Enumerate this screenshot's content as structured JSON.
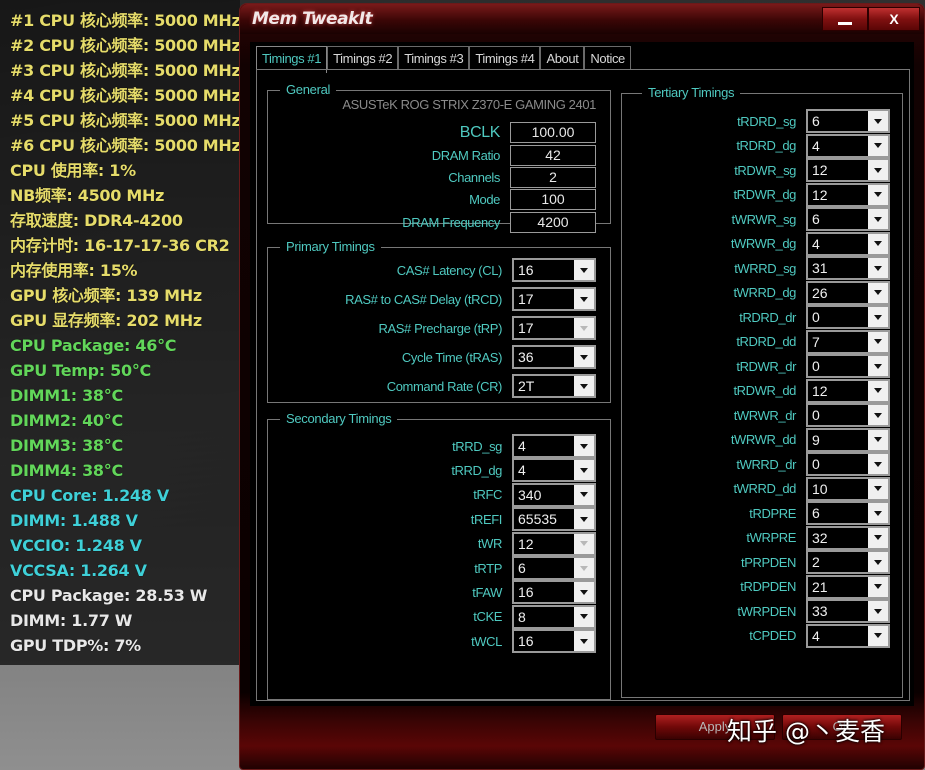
{
  "osd": {
    "lines": [
      {
        "text": "#1 CPU 核心频率: 5000 MHz",
        "color": "yellow"
      },
      {
        "text": "#2 CPU 核心频率: 5000 MHz",
        "color": "yellow"
      },
      {
        "text": "#3 CPU 核心频率: 5000 MHz",
        "color": "yellow"
      },
      {
        "text": "#4 CPU 核心频率: 5000 MHz",
        "color": "yellow"
      },
      {
        "text": "#5 CPU 核心频率: 5000 MHz",
        "color": "yellow"
      },
      {
        "text": "#6 CPU 核心频率: 5000 MHz",
        "color": "yellow"
      },
      {
        "text": "CPU 使用率: 1%",
        "color": "yellow"
      },
      {
        "text": "NB频率: 4500 MHz",
        "color": "yellow"
      },
      {
        "text": "存取速度: DDR4-4200",
        "color": "yellow"
      },
      {
        "text": "内存计时: 16-17-17-36 CR2",
        "color": "yellow"
      },
      {
        "text": "内存使用率: 15%",
        "color": "yellow"
      },
      {
        "text": "GPU 核心频率: 139 MHz",
        "color": "yellow"
      },
      {
        "text": "GPU 显存频率: 202 MHz",
        "color": "yellow"
      },
      {
        "text": "CPU Package: 46°C",
        "color": "green"
      },
      {
        "text": "GPU Temp: 50°C",
        "color": "green"
      },
      {
        "text": "DIMM1: 38°C",
        "color": "green"
      },
      {
        "text": "DIMM2: 40°C",
        "color": "green"
      },
      {
        "text": "DIMM3: 38°C",
        "color": "green"
      },
      {
        "text": "DIMM4: 38°C",
        "color": "green"
      },
      {
        "text": "CPU Core: 1.248 V",
        "color": "cyan"
      },
      {
        "text": "DIMM: 1.488 V",
        "color": "cyan"
      },
      {
        "text": "VCCIO: 1.248 V",
        "color": "cyan"
      },
      {
        "text": "VCCSA: 1.264 V",
        "color": "cyan"
      },
      {
        "text": "CPU Package: 28.53 W",
        "color": "white"
      },
      {
        "text": "DIMM: 1.77 W",
        "color": "white"
      },
      {
        "text": "GPU TDP%: 7%",
        "color": "white"
      }
    ]
  },
  "window": {
    "title": "Mem TweakIt",
    "minimize_icon": "minimize-icon",
    "close_label": "X",
    "tabs": [
      {
        "label": "Timings #1",
        "active": true
      },
      {
        "label": "Timings #2",
        "active": false
      },
      {
        "label": "Timings #3",
        "active": false
      },
      {
        "label": "Timings #4",
        "active": false
      },
      {
        "label": "About",
        "active": false
      },
      {
        "label": "Notice",
        "active": false
      }
    ],
    "general": {
      "title": "General",
      "board": "ASUSTeK ROG STRIX Z370-E GAMING 2401",
      "fields": [
        {
          "label": "BCLK",
          "value": "100.00"
        },
        {
          "label": "DRAM Ratio",
          "value": "42"
        },
        {
          "label": "Channels",
          "value": "2"
        },
        {
          "label": "Mode",
          "value": "100"
        },
        {
          "label": "DRAM Frequency",
          "value": "4200"
        }
      ]
    },
    "primary": {
      "title": "Primary Timings",
      "fields": [
        {
          "label": "CAS# Latency (CL)",
          "value": "16",
          "disabled": false
        },
        {
          "label": "RAS# to CAS# Delay (tRCD)",
          "value": "17",
          "disabled": false
        },
        {
          "label": "RAS# Precharge (tRP)",
          "value": "17",
          "disabled": true
        },
        {
          "label": "Cycle Time (tRAS)",
          "value": "36",
          "disabled": false
        },
        {
          "label": "Command Rate (CR)",
          "value": "2T",
          "disabled": false
        }
      ]
    },
    "secondary": {
      "title": "Secondary Timings",
      "fields": [
        {
          "label": "tRRD_sg",
          "value": "4",
          "disabled": false
        },
        {
          "label": "tRRD_dg",
          "value": "4",
          "disabled": false
        },
        {
          "label": "tRFC",
          "value": "340",
          "disabled": false
        },
        {
          "label": "tREFI",
          "value": "65535",
          "disabled": false
        },
        {
          "label": "tWR",
          "value": "12",
          "disabled": true
        },
        {
          "label": "tRTP",
          "value": "6",
          "disabled": true
        },
        {
          "label": "tFAW",
          "value": "16",
          "disabled": false
        },
        {
          "label": "tCKE",
          "value": "8",
          "disabled": false
        },
        {
          "label": "tWCL",
          "value": "16",
          "disabled": false
        }
      ]
    },
    "tertiary": {
      "title": "Tertiary Timings",
      "fields": [
        {
          "label": "tRDRD_sg",
          "value": "6"
        },
        {
          "label": "tRDRD_dg",
          "value": "4"
        },
        {
          "label": "tRDWR_sg",
          "value": "12"
        },
        {
          "label": "tRDWR_dg",
          "value": "12"
        },
        {
          "label": "tWRWR_sg",
          "value": "6"
        },
        {
          "label": "tWRWR_dg",
          "value": "4"
        },
        {
          "label": "tWRRD_sg",
          "value": "31"
        },
        {
          "label": "tWRRD_dg",
          "value": "26"
        },
        {
          "label": "tRDRD_dr",
          "value": "0"
        },
        {
          "label": "tRDRD_dd",
          "value": "7"
        },
        {
          "label": "tRDWR_dr",
          "value": "0"
        },
        {
          "label": "tRDWR_dd",
          "value": "12"
        },
        {
          "label": "tWRWR_dr",
          "value": "0"
        },
        {
          "label": "tWRWR_dd",
          "value": "9"
        },
        {
          "label": "tWRRD_dr",
          "value": "0"
        },
        {
          "label": "tWRRD_dd",
          "value": "10"
        },
        {
          "label": "tRDPRE",
          "value": "6"
        },
        {
          "label": "tWRPRE",
          "value": "32"
        },
        {
          "label": "tPRPDEN",
          "value": "2"
        },
        {
          "label": "tRDPDEN",
          "value": "21"
        },
        {
          "label": "tWRPDEN",
          "value": "33"
        },
        {
          "label": "tCPDED",
          "value": "4"
        }
      ]
    },
    "footer": {
      "apply_label": "Apply",
      "ok_label": "OK"
    }
  },
  "watermark": "知乎 @丶麦香"
}
